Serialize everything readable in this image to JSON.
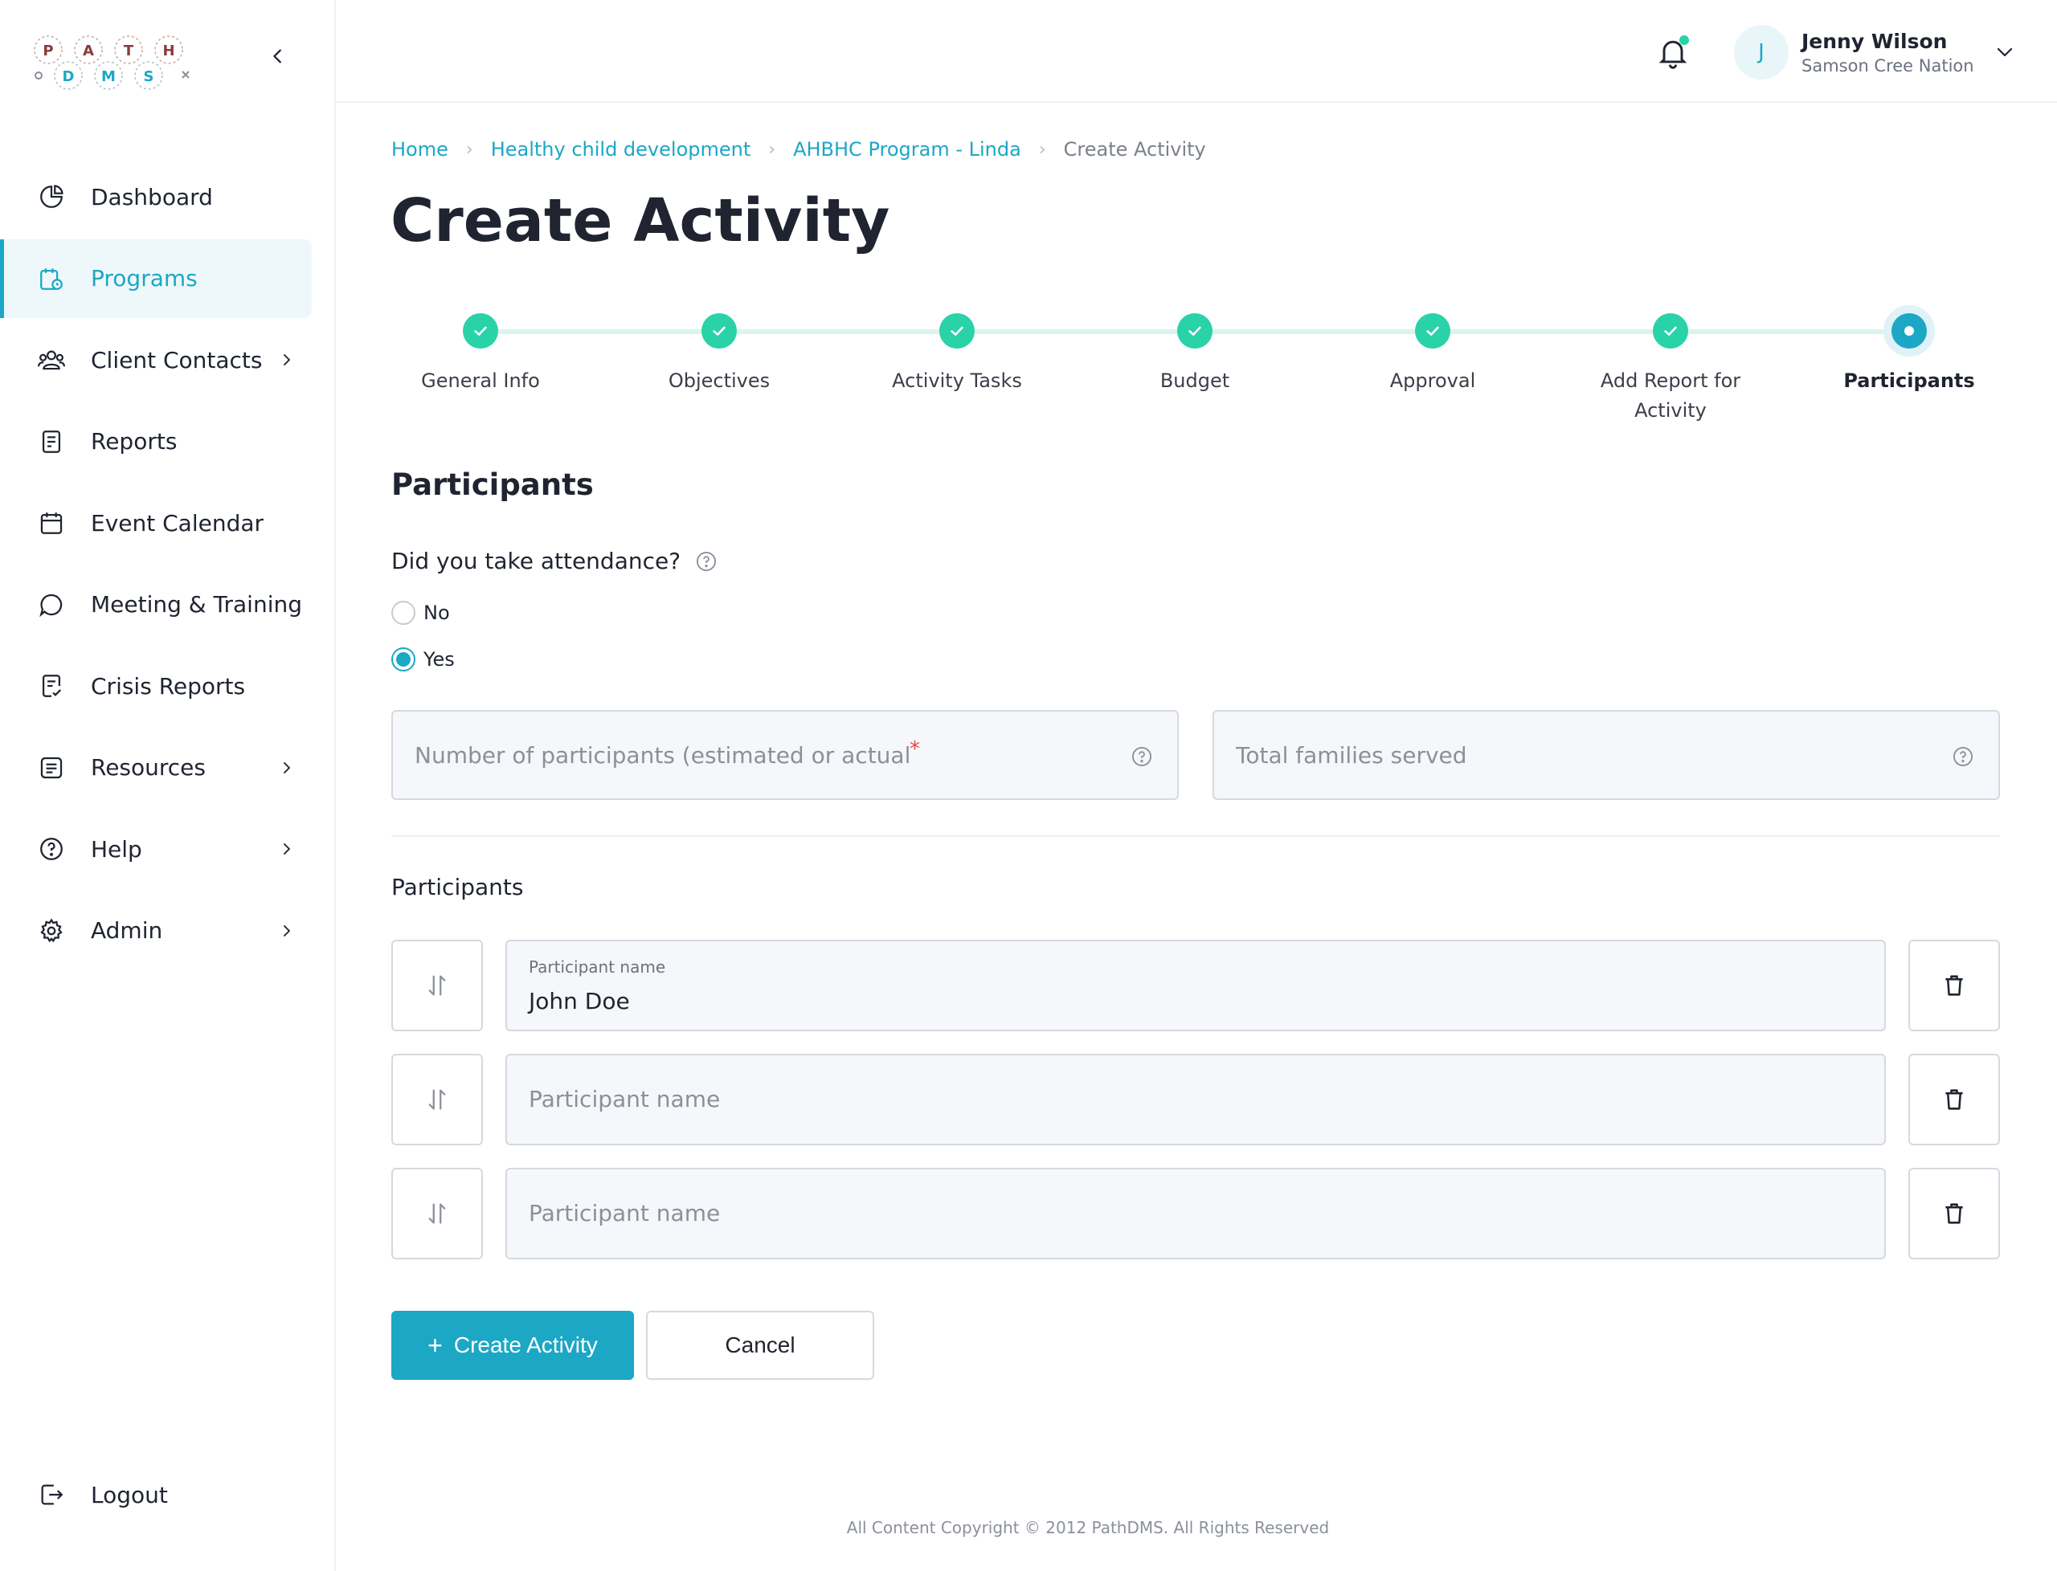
{
  "app": {
    "logo_letters_top": [
      "P",
      "A",
      "T",
      "H"
    ],
    "logo_letters_bottom": [
      "D",
      "M",
      "S"
    ]
  },
  "sidebar": {
    "items": [
      {
        "label": "Dashboard",
        "icon": "dashboard-icon",
        "has_submenu": false,
        "active": false
      },
      {
        "label": "Programs",
        "icon": "programs-icon",
        "has_submenu": false,
        "active": true
      },
      {
        "label": "Client Contacts",
        "icon": "client-contacts-icon",
        "has_submenu": true,
        "active": false
      },
      {
        "label": "Reports",
        "icon": "reports-icon",
        "has_submenu": false,
        "active": false
      },
      {
        "label": "Event Calendar",
        "icon": "calendar-icon",
        "has_submenu": false,
        "active": false
      },
      {
        "label": "Meeting & Training",
        "icon": "chat-bubble-icon",
        "has_submenu": false,
        "active": false
      },
      {
        "label": "Crisis Reports",
        "icon": "crisis-reports-icon",
        "has_submenu": false,
        "active": false
      },
      {
        "label": "Resources",
        "icon": "resources-icon",
        "has_submenu": true,
        "active": false
      },
      {
        "label": "Help",
        "icon": "help-icon",
        "has_submenu": true,
        "active": false
      },
      {
        "label": "Admin",
        "icon": "gear-icon",
        "has_submenu": true,
        "active": false
      }
    ],
    "logout_label": "Logout"
  },
  "header": {
    "user_initial": "J",
    "user_name": "Jenny Wilson",
    "user_org": "Samson Cree Nation"
  },
  "breadcrumb": [
    {
      "label": "Home",
      "link": true
    },
    {
      "label": "Healthy child development",
      "link": true
    },
    {
      "label": "AHBHC Program - Linda",
      "link": true
    },
    {
      "label": "Create Activity",
      "link": false
    }
  ],
  "page_title": "Create Activity",
  "stepper": {
    "steps": [
      {
        "label": "General Info",
        "state": "done"
      },
      {
        "label": "Objectives",
        "state": "done"
      },
      {
        "label": "Activity Tasks",
        "state": "done"
      },
      {
        "label": "Budget",
        "state": "done"
      },
      {
        "label": "Approval",
        "state": "done"
      },
      {
        "label": "Add Report for Activity",
        "state": "done"
      },
      {
        "label": "Participants",
        "state": "current"
      }
    ]
  },
  "form": {
    "section_title": "Participants",
    "attendance_question": "Did you take attendance?",
    "attendance_options": [
      {
        "label": "No",
        "checked": false
      },
      {
        "label": "Yes",
        "checked": true
      }
    ],
    "participants_count_placeholder": "Number of participants (estimated or actual)",
    "required_mark": "*",
    "families_placeholder": "Total families served",
    "participants_subtitle": "Participants",
    "participant_field_label": "Participant name",
    "participants": [
      {
        "value": "John Doe",
        "placeholder": "Participant name"
      },
      {
        "value": "",
        "placeholder": "Participant name"
      },
      {
        "value": "",
        "placeholder": "Participant name"
      }
    ],
    "submit_label": "Create Activity",
    "cancel_label": "Cancel"
  },
  "footer": "All Content Copyright © 2012 PathDMS. All Rights Reserved",
  "colors": {
    "accent": "#1ca7c5",
    "success": "#2ad2a8",
    "text": "#1f2430"
  }
}
